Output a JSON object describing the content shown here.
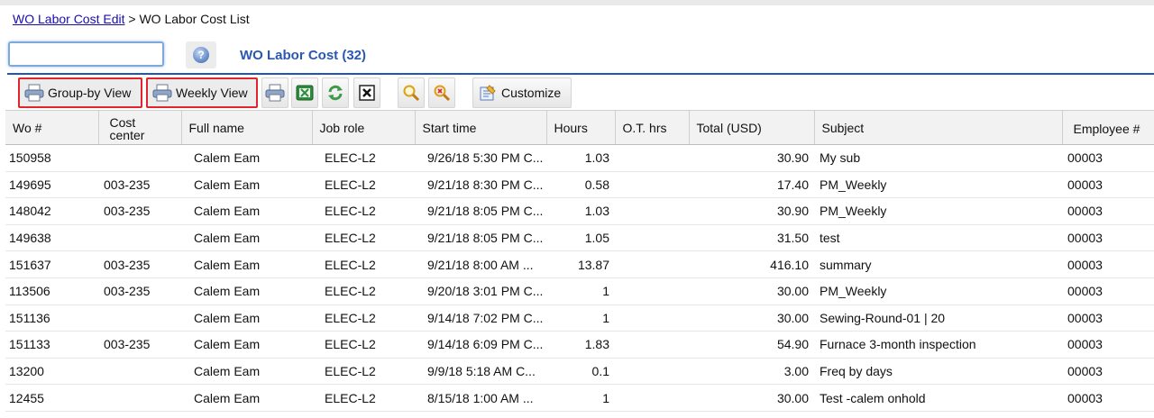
{
  "breadcrumb": {
    "link": "WO Labor Cost Edit",
    "separator": " > ",
    "current": "WO Labor Cost List"
  },
  "search": {
    "value": "",
    "placeholder": ""
  },
  "list_title": "WO Labor Cost (32)",
  "toolbar": {
    "group_by_view": "Group-by View",
    "weekly_view": "Weekly View",
    "customize": "Customize",
    "icons": [
      "printer-icon",
      "excel-export-icon",
      "refresh-icon",
      "close-icon",
      "search-icon",
      "clear-search-icon",
      "customize-icon"
    ]
  },
  "colors": {
    "accent": "#1f56b7",
    "title": "#2a57b0",
    "highlight_box": "#e0262d"
  },
  "table": {
    "headers": [
      "Wo #",
      "Cost center",
      "Full name",
      "Job role",
      "Start time",
      "Hours",
      "O.T. hrs",
      "Total (USD)",
      "Subject",
      "Employee #"
    ],
    "rows": [
      [
        "150958",
        "",
        "Calem Eam",
        "ELEC-L2",
        "9/26/18 5:30 PM C...",
        "1.03",
        "",
        "30.90",
        "My sub",
        "00003"
      ],
      [
        "149695",
        "003-235",
        "Calem Eam",
        "ELEC-L2",
        "9/21/18 8:30 PM C...",
        "0.58",
        "",
        "17.40",
        "PM_Weekly",
        "00003"
      ],
      [
        "148042",
        "003-235",
        "Calem Eam",
        "ELEC-L2",
        "9/21/18 8:05 PM C...",
        "1.03",
        "",
        "30.90",
        "PM_Weekly",
        "00003"
      ],
      [
        "149638",
        "",
        "Calem Eam",
        "ELEC-L2",
        "9/21/18 8:05 PM C...",
        "1.05",
        "",
        "31.50",
        "test",
        "00003"
      ],
      [
        "151637",
        "003-235",
        "Calem Eam",
        "ELEC-L2",
        "9/21/18 8:00 AM ...",
        "13.87",
        "",
        "416.10",
        "summary",
        "00003"
      ],
      [
        "113506",
        "003-235",
        "Calem Eam",
        "ELEC-L2",
        "9/20/18 3:01 PM C...",
        "1",
        "",
        "30.00",
        "PM_Weekly",
        "00003"
      ],
      [
        "151136",
        "",
        "Calem Eam",
        "ELEC-L2",
        "9/14/18 7:02 PM C...",
        "1",
        "",
        "30.00",
        "Sewing-Round-01 | 20",
        "00003"
      ],
      [
        "151133",
        "003-235",
        "Calem Eam",
        "ELEC-L2",
        "9/14/18 6:09 PM C...",
        "1.83",
        "",
        "54.90",
        "Furnace 3-month inspection",
        "00003"
      ],
      [
        "13200",
        "",
        "Calem Eam",
        "ELEC-L2",
        "9/9/18 5:18 AM C...",
        "0.1",
        "",
        "3.00",
        "Freq by days",
        "00003"
      ],
      [
        "12455",
        "",
        "Calem Eam",
        "ELEC-L2",
        "8/15/18 1:00 AM ...",
        "1",
        "",
        "30.00",
        "Test -calem onhold",
        "00003"
      ]
    ]
  }
}
